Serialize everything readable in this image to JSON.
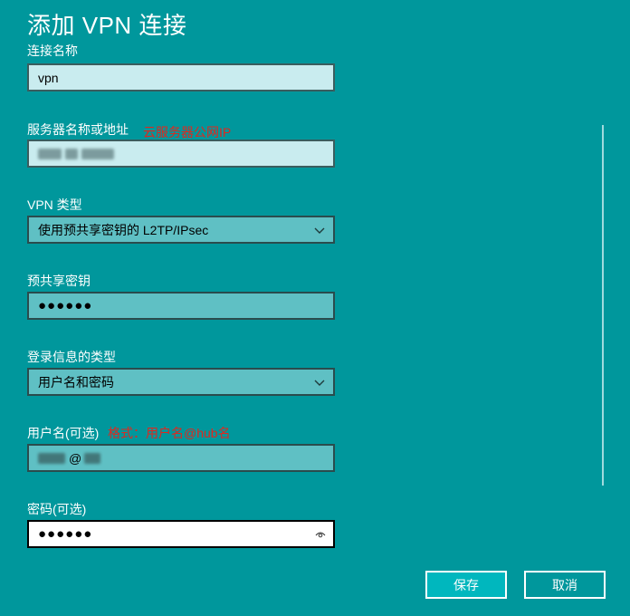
{
  "title": "添加 VPN 连接",
  "fields": {
    "connection_name": {
      "label": "连接名称",
      "value": "vpn"
    },
    "server": {
      "label": "服务器名称或地址",
      "annotation": "云服务器公网IP",
      "value": "",
      "masked": true
    },
    "vpn_type": {
      "label": "VPN 类型",
      "value": "使用预共享密钥的 L2TP/IPsec"
    },
    "preshared_key": {
      "label": "预共享密钥",
      "value": "●●●●●●"
    },
    "signin_type": {
      "label": "登录信息的类型",
      "value": "用户名和密码"
    },
    "username": {
      "label": "用户名(可选)",
      "annotation": "格式：用户名@hub名",
      "value": "@",
      "masked": true
    },
    "password": {
      "label": "密码(可选)",
      "value": "●●●●●●"
    }
  },
  "buttons": {
    "save": "保存",
    "cancel": "取消"
  },
  "icons": {
    "dropdown": "chevron-down-icon",
    "reveal": "eye-icon"
  },
  "colors": {
    "background": "#00979c",
    "annotation": "#e0281e",
    "save_button": "#00b7be"
  }
}
